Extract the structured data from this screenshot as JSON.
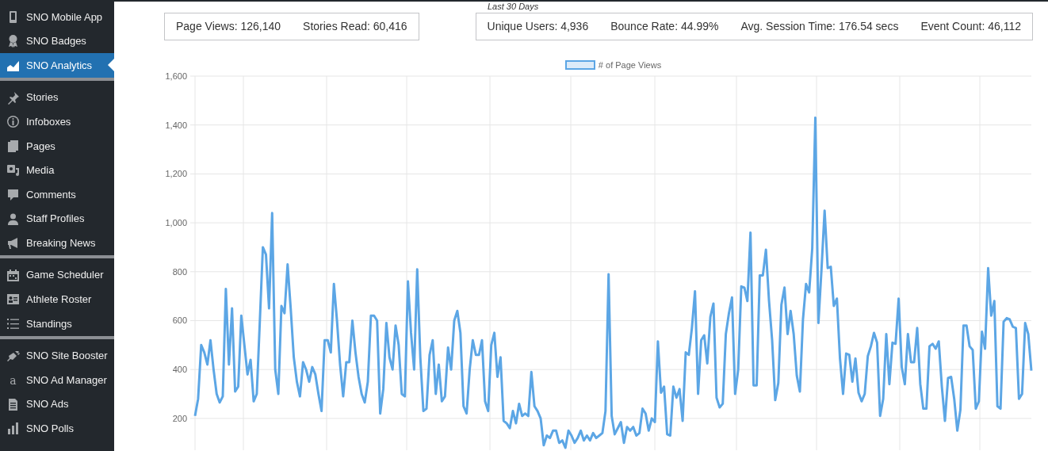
{
  "sidebar": {
    "groups": [
      {
        "items": [
          {
            "label": "SNO Mobile App",
            "selected": false
          },
          {
            "label": "SNO Badges",
            "selected": false
          },
          {
            "label": "SNO Analytics",
            "selected": true
          }
        ]
      },
      {
        "items": [
          {
            "label": "Stories",
            "selected": false
          },
          {
            "label": "Infoboxes",
            "selected": false
          },
          {
            "label": "Pages",
            "selected": false
          },
          {
            "label": "Media",
            "selected": false
          },
          {
            "label": "Comments",
            "selected": false
          },
          {
            "label": "Staff Profiles",
            "selected": false
          },
          {
            "label": "Breaking News",
            "selected": false
          }
        ]
      },
      {
        "items": [
          {
            "label": "Game Scheduler",
            "selected": false
          },
          {
            "label": "Athlete Roster",
            "selected": false
          },
          {
            "label": "Standings",
            "selected": false
          }
        ]
      },
      {
        "items": [
          {
            "label": "SNO Site Booster",
            "selected": false
          },
          {
            "label": "SNO Ad Manager",
            "selected": false,
            "icon_text": "a"
          },
          {
            "label": "SNO Ads",
            "selected": false
          },
          {
            "label": "SNO Polls",
            "selected": false
          }
        ]
      }
    ]
  },
  "period_label": "Last 30 Days",
  "stat_panels": [
    {
      "stats": [
        "Page Views: 126,140",
        "Stories Read: 60,416"
      ]
    },
    {
      "stats": [
        "Unique Users: 4,936",
        "Bounce Rate: 44.99%",
        "Avg. Session Time: 176.54 secs",
        "Event Count: 46,112"
      ]
    }
  ],
  "chart": {
    "chart_data": {
      "type": "line",
      "grid": true,
      "ylim": [
        70,
        1600
      ],
      "yticks": [
        {
          "value": 200,
          "label": "200"
        },
        {
          "value": 400,
          "label": "400"
        },
        {
          "value": 600,
          "label": "600"
        },
        {
          "value": 800,
          "label": "800"
        },
        {
          "value": 1000,
          "label": "1,000"
        },
        {
          "value": 1200,
          "label": "1,200"
        },
        {
          "value": 1400,
          "label": "1,400"
        },
        {
          "value": 1600,
          "label": "1,600"
        }
      ],
      "series": [
        {
          "name": "# of Page Views",
          "color": "#5ca6e5",
          "values": [
            210,
            280,
            500,
            470,
            420,
            520,
            400,
            300,
            265,
            290,
            730,
            420,
            650,
            310,
            330,
            620,
            500,
            380,
            440,
            270,
            300,
            600,
            900,
            870,
            650,
            1040,
            400,
            300,
            660,
            630,
            830,
            650,
            450,
            350,
            290,
            430,
            400,
            350,
            410,
            380,
            300,
            230,
            520,
            520,
            470,
            750,
            600,
            420,
            290,
            430,
            430,
            600,
            470,
            370,
            300,
            265,
            350,
            620,
            620,
            600,
            220,
            320,
            590,
            450,
            400,
            580,
            500,
            300,
            290,
            760,
            550,
            400,
            810,
            450,
            230,
            240,
            460,
            520,
            300,
            420,
            270,
            290,
            490,
            400,
            600,
            640,
            550,
            250,
            220,
            400,
            520,
            460,
            460,
            520,
            270,
            230,
            500,
            550,
            370,
            450,
            190,
            180,
            160,
            230,
            180,
            260,
            210,
            220,
            210,
            390,
            250,
            230,
            200,
            90,
            130,
            120,
            150,
            150,
            100,
            110,
            80,
            150,
            130,
            100,
            120,
            150,
            110,
            130,
            110,
            140,
            120,
            130,
            140,
            230,
            790,
            210,
            135,
            160,
            185,
            100,
            165,
            150,
            165,
            130,
            140,
            240,
            220,
            150,
            200,
            185,
            515,
            305,
            330,
            135,
            130,
            330,
            285,
            320,
            190,
            470,
            460,
            570,
            720,
            300,
            520,
            540,
            425,
            615,
            670,
            285,
            245,
            260,
            545,
            630,
            695,
            300,
            400,
            740,
            735,
            680,
            960,
            335,
            335,
            785,
            785,
            890,
            680,
            520,
            275,
            345,
            665,
            735,
            545,
            640,
            545,
            375,
            310,
            605,
            750,
            715,
            895,
            1430,
            590,
            810,
            1050,
            815,
            820,
            660,
            690,
            445,
            300,
            465,
            460,
            350,
            445,
            305,
            270,
            300,
            455,
            495,
            550,
            510,
            210,
            280,
            545,
            340,
            510,
            505,
            690,
            410,
            340,
            545,
            430,
            430,
            570,
            340,
            240,
            240,
            495,
            505,
            485,
            515,
            330,
            190,
            365,
            370,
            280,
            150,
            235,
            580,
            580,
            495,
            480,
            240,
            270,
            555,
            485,
            815,
            620,
            680,
            250,
            240,
            595,
            610,
            605,
            575,
            570,
            280,
            300,
            590,
            545,
            395
          ]
        }
      ]
    }
  }
}
